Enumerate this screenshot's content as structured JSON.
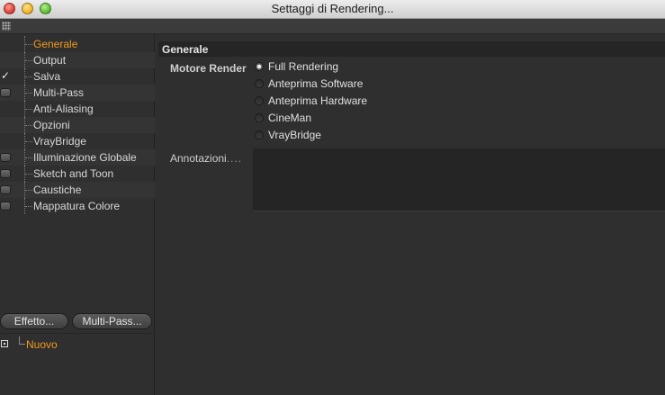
{
  "window": {
    "title": "Settaggi di Rendering..."
  },
  "sidebar": {
    "items": [
      {
        "label": "Generale",
        "checkbox": "none",
        "selected": true
      },
      {
        "label": "Output",
        "checkbox": "none",
        "selected": false
      },
      {
        "label": "Salva",
        "checkbox": "checked",
        "selected": false
      },
      {
        "label": "Multi-Pass",
        "checkbox": "box",
        "selected": false
      },
      {
        "label": "Anti-Aliasing",
        "checkbox": "none",
        "selected": false
      },
      {
        "label": "Opzioni",
        "checkbox": "none",
        "selected": false
      },
      {
        "label": "VrayBridge",
        "checkbox": "none",
        "selected": false
      },
      {
        "label": "Illuminazione Globale",
        "checkbox": "box",
        "selected": false
      },
      {
        "label": "Sketch and Toon",
        "checkbox": "box",
        "selected": false
      },
      {
        "label": "Caustiche",
        "checkbox": "box",
        "selected": false
      },
      {
        "label": "Mappatura Colore",
        "checkbox": "box",
        "selected": false
      }
    ],
    "buttons": {
      "effetto": "Effetto...",
      "multipass": "Multi-Pass..."
    },
    "presets": {
      "new_label": "Nuovo"
    }
  },
  "main": {
    "section_title": "Generale",
    "render_engine": {
      "label": "Motore Render",
      "options": [
        "Full Rendering",
        "Anteprima Software",
        "Anteprima Hardware",
        "CineMan",
        "VrayBridge"
      ],
      "selected": "Full Rendering"
    },
    "annotations": {
      "label": "Annotazioni",
      "dots": "....",
      "value": ""
    }
  },
  "colors": {
    "accent": "#f29b1a",
    "background": "#2f2f2f",
    "header": "#252525"
  }
}
